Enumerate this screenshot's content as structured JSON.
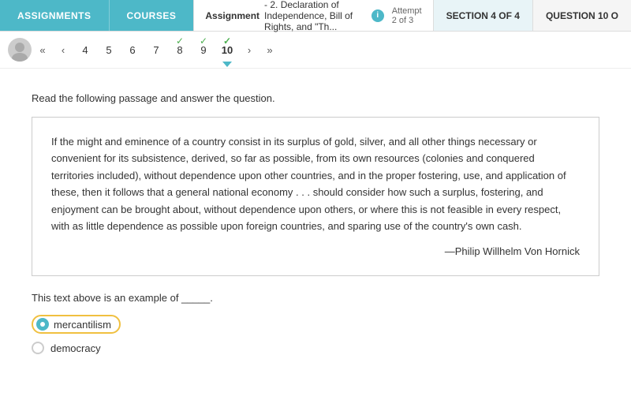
{
  "nav": {
    "assignments_label": "ASSIGNMENTS",
    "courses_label": "CouRSES",
    "assignment_bold": "Assignment",
    "assignment_title": " - 2. Declaration of Independence, Bill of Rights, and \"Th...",
    "attempt": "Attempt 2 of 3",
    "section": "SECTION 4 OF 4",
    "question": "QUESTION 10 O"
  },
  "pagination": {
    "pages": [
      {
        "num": "4",
        "check": false,
        "active": false
      },
      {
        "num": "5",
        "check": false,
        "active": false
      },
      {
        "num": "6",
        "check": false,
        "active": false
      },
      {
        "num": "7",
        "check": false,
        "active": false
      },
      {
        "num": "8",
        "check": true,
        "active": false
      },
      {
        "num": "9",
        "check": true,
        "active": false
      },
      {
        "num": "10",
        "check": true,
        "active": true
      }
    ]
  },
  "content": {
    "instruction": "Read the following passage and answer the question.",
    "passage": "If the might and eminence of a country consist in its surplus of gold, silver, and all other things necessary or convenient for its subsistence, derived, so far as possible, from its own resources (colonies and conquered territories included), without dependence upon other countries, and in the proper fostering, use, and application of these, then it follows that a general national economy . . . should consider how such a surplus, fostering, and enjoyment can be brought about, without dependence upon others, or where this is not feasible in every respect, with as little dependence as possible upon foreign countries, and sparing use of the country's own cash.",
    "attribution": "—Philip Willhelm Von Hornick",
    "question": "This text above is an example of _____.",
    "options": [
      {
        "id": "opt1",
        "text": "mercantilism",
        "selected": true
      },
      {
        "id": "opt2",
        "text": "democracy",
        "selected": false
      }
    ]
  }
}
